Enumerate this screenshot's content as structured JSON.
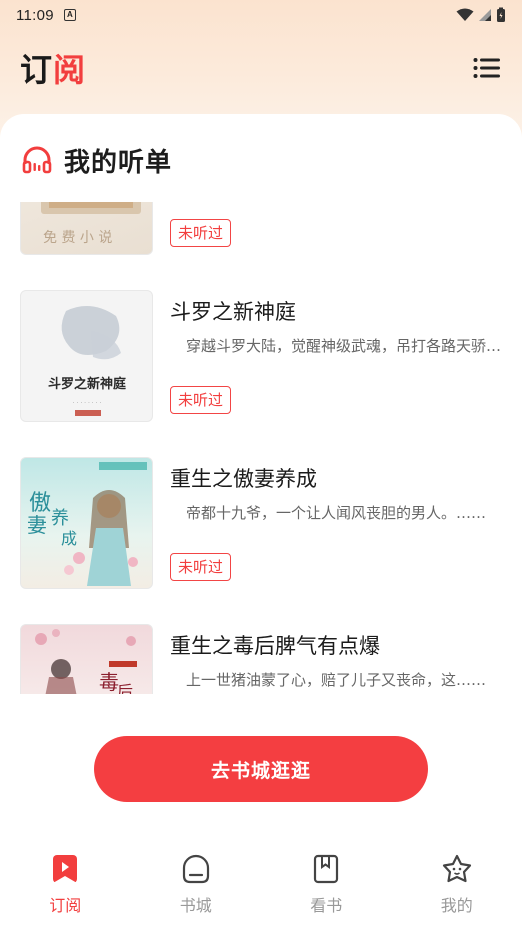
{
  "status_bar": {
    "time": "11:09"
  },
  "header": {
    "title_part1": "订",
    "title_part2": "阅"
  },
  "section": {
    "title": "我的听单"
  },
  "books": [
    {
      "title": "",
      "desc": "",
      "tag": "未听过",
      "cover_text": "免费小说"
    },
    {
      "title": "斗罗之新神庭",
      "desc": "穿越斗罗大陆，觉醒神级武魂，吊打各路天骄……",
      "tag": "未听过",
      "cover_text": "斗罗之新神庭"
    },
    {
      "title": "重生之傲妻养成",
      "desc": "帝都十九爷，一个让人闻风丧胆的男人。……",
      "tag": "未听过",
      "cover_text": "傲妻养成"
    },
    {
      "title": "重生之毒后脾气有点爆",
      "desc": "上一世猪油蒙了心，赔了儿子又丧命，这……",
      "tag": "",
      "cover_text": "毒后"
    }
  ],
  "cta": {
    "label": "去书城逛逛"
  },
  "nav": [
    {
      "label": "订阅",
      "icon": "bookmark-icon",
      "active": true
    },
    {
      "label": "书城",
      "icon": "bookstore-icon",
      "active": false
    },
    {
      "label": "看书",
      "icon": "book-icon",
      "active": false
    },
    {
      "label": "我的",
      "icon": "profile-star-icon",
      "active": false
    }
  ],
  "colors": {
    "accent": "#f23e3e",
    "cta": "#f43e41"
  }
}
